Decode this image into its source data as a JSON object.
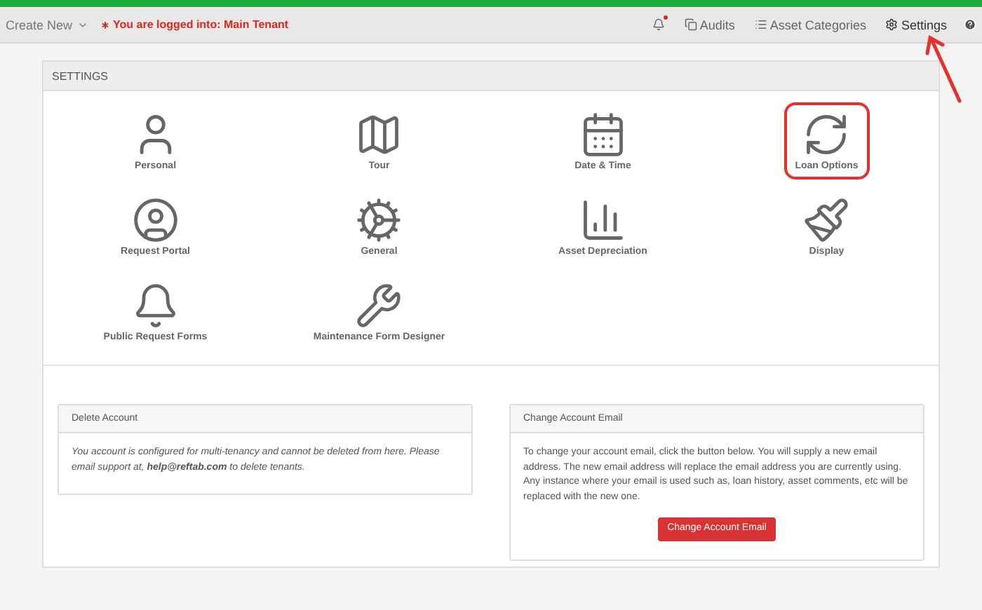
{
  "toolbar": {
    "create_new": "Create New",
    "login_notice": "You are logged into: Main Tenant",
    "notification_badge": true,
    "links": [
      {
        "kind": "audits",
        "label": "Audits"
      },
      {
        "kind": "categories",
        "label": "Asset Categories"
      },
      {
        "kind": "settings",
        "label": "Settings"
      }
    ]
  },
  "settings_panel": {
    "title": "SETTINGS",
    "items": [
      {
        "kind": "personal",
        "label": "Personal",
        "highlighted": false
      },
      {
        "kind": "tour",
        "label": "Tour",
        "highlighted": false
      },
      {
        "kind": "datetime",
        "label": "Date & Time",
        "highlighted": false
      },
      {
        "kind": "loan",
        "label": "Loan Options",
        "highlighted": true
      },
      {
        "kind": "portal",
        "label": "Request Portal",
        "highlighted": false
      },
      {
        "kind": "general",
        "label": "General",
        "highlighted": false
      },
      {
        "kind": "depreciation",
        "label": "Asset Depreciation",
        "highlighted": false
      },
      {
        "kind": "display",
        "label": "Display",
        "highlighted": false
      },
      {
        "kind": "forms",
        "label": "Public Request Forms",
        "highlighted": false
      },
      {
        "kind": "maintenance",
        "label": "Maintenance Form Designer",
        "highlighted": false
      }
    ]
  },
  "delete_account": {
    "title": "Delete Account",
    "text": "You account is configured for multi-tenancy and cannot be deleted from here. Please email support at, **help@reftab.com** to delete tenants."
  },
  "change_email": {
    "title": "Change Account Email",
    "text": "To change your account email, click the button below. You will supply a new email address. The new email address will replace the email address you are currently using. Any instance where your email is used such as, loan history, asset comments, etc will be replaced with the new one.",
    "button": "Change Account Email"
  }
}
